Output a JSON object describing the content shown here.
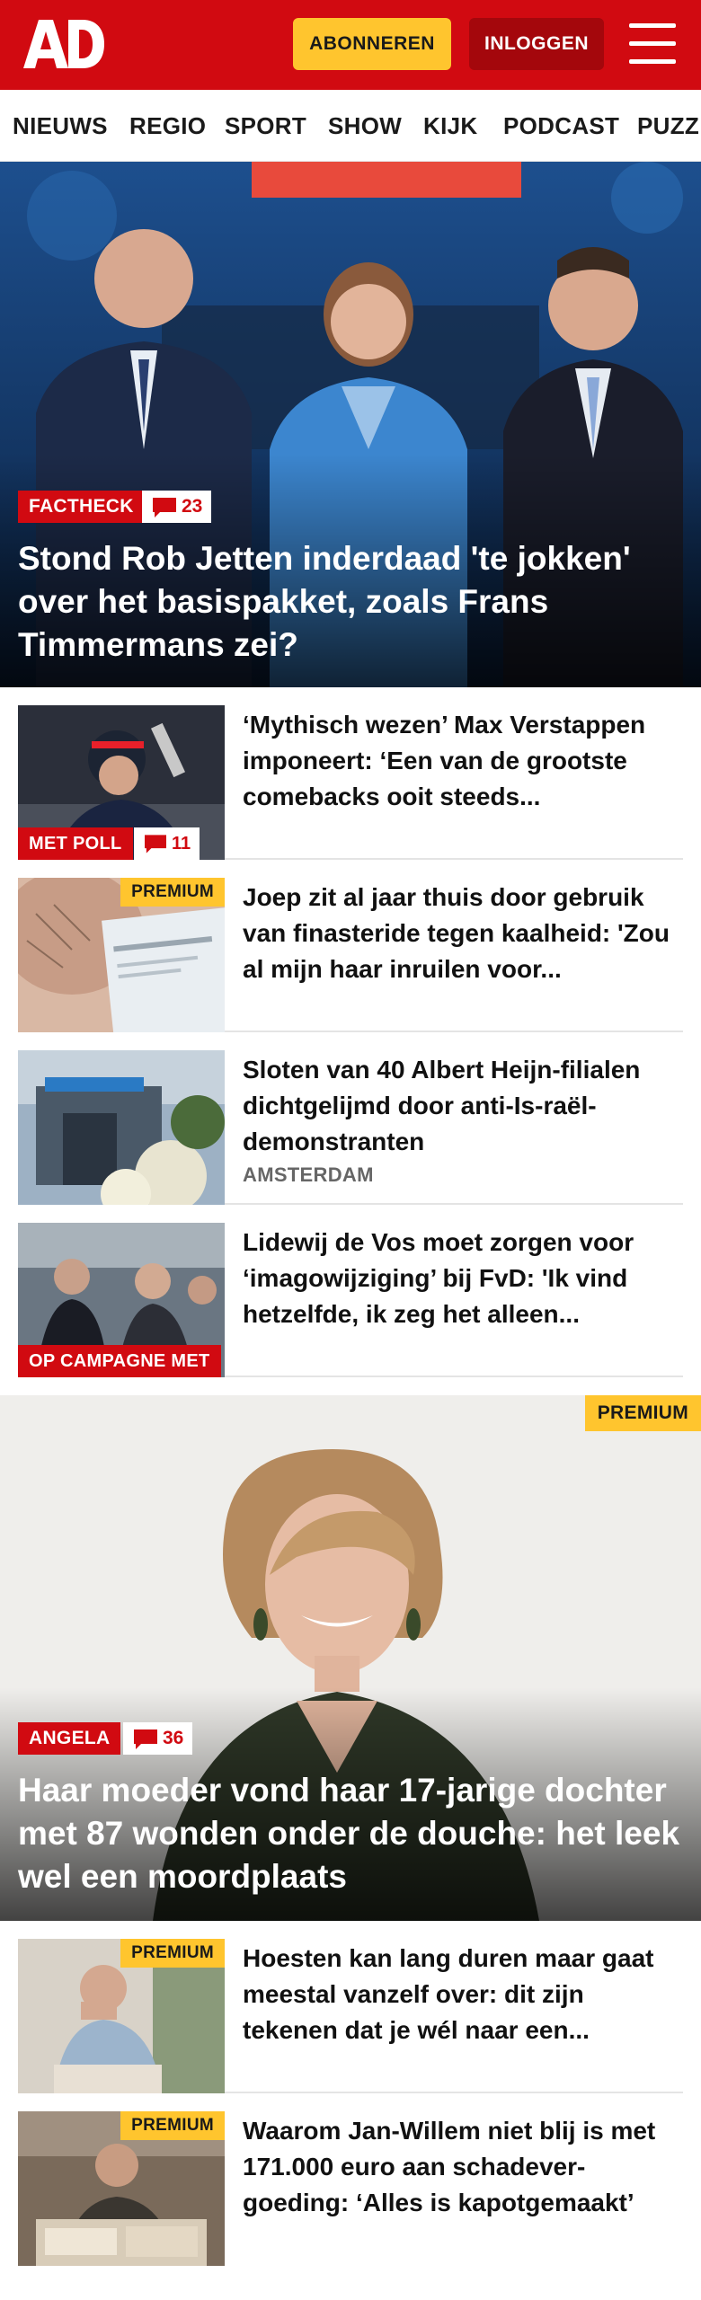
{
  "header": {
    "logo_text": "AD",
    "subscribe_label": "ABONNEREN",
    "login_label": "INLOGGEN"
  },
  "nav": {
    "items": [
      "NIEUWS",
      "REGIO",
      "SPORT",
      "SHOW",
      "KIJK",
      "PODCAST",
      "PUZZ"
    ]
  },
  "hero": {
    "tag": "FACTHECK",
    "comments": "23",
    "title": "Stond Rob Jetten inderdaad 'te jokken' over het basispakket, zoals Frans Timmermans zei?"
  },
  "articles": [
    {
      "title": "‘Mythisch wezen’ Max Verstappen imponeert: ‘Een van de grootste comebacks ooit steeds...",
      "tag": "MET POLL",
      "comments": "11"
    },
    {
      "title": "Joep zit al jaar thuis door gebruik van finasteride tegen kaalheid: 'Zou al mijn haar inruilen voor...",
      "premium": "PREMIUM"
    },
    {
      "title": "Sloten van 40 Albert Heijn-filialen dichtgelijmd door anti-Is-raël-demonstranten",
      "label": "AMSTERDAM"
    },
    {
      "title": "Lidewij de Vos moet zorgen voor ‘imagowijziging’ bij FvD: 'Ik vind hetzelfde, ik zeg het alleen...",
      "tag": "OP CAMPAGNE MET"
    }
  ],
  "feature": {
    "premium": "PREMIUM",
    "tag": "ANGELA",
    "comments": "36",
    "title": "Haar moeder vond haar 17-jarige dochter met 87 wonden onder de douche: het leek wel een moordplaats"
  },
  "articles2": [
    {
      "title": "Hoesten kan lang duren maar gaat meestal vanzelf over: dit zijn tekenen dat je wél naar een...",
      "premium": "PREMIUM"
    },
    {
      "title": "Waarom Jan-Willem niet blij is met 171.000 euro aan schadever-goeding: ‘Alles is kapotgemaakt’",
      "premium": "PREMIUM"
    }
  ],
  "colors": {
    "brand_red": "#d10a11",
    "premium_yellow": "#ffc52e",
    "login_dark_red": "#a4070c"
  }
}
